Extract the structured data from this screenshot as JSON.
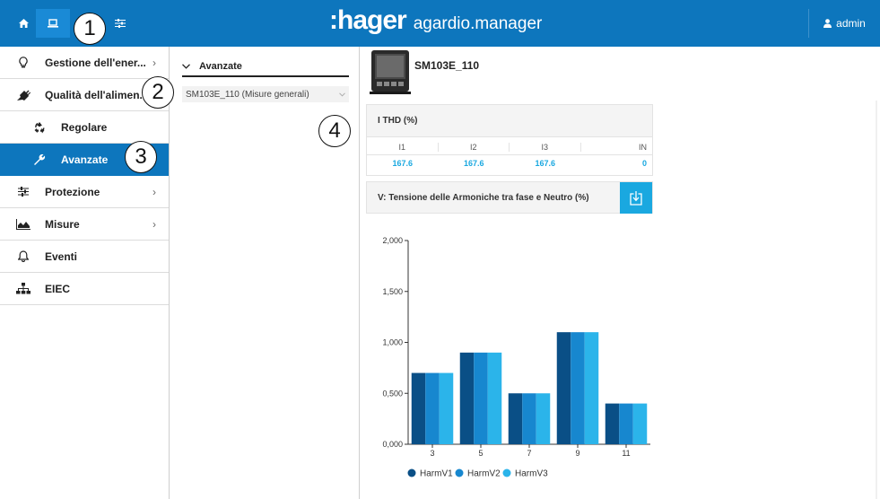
{
  "topbar": {
    "tabs": [
      {
        "name": "home",
        "icon": "home-icon"
      },
      {
        "name": "device",
        "icon": "laptop-icon"
      },
      {
        "name": "settings",
        "icon": "sliders-icon"
      }
    ],
    "brand_logo": ":hager",
    "brand_product": "agardio.manager",
    "user": "admin"
  },
  "callouts": [
    "1",
    "2",
    "3",
    "4"
  ],
  "sidebar": {
    "items": [
      {
        "label": "Gestione dell'ener...",
        "icon": "lightbulb-icon",
        "chevron": "›"
      },
      {
        "label": "Qualità dell'alimen.",
        "icon": "plug-icon",
        "chevron": ""
      },
      {
        "label": "Regolare",
        "icon": "recycle-icon",
        "chevron": ""
      },
      {
        "label": "Avanzate",
        "icon": "wrench-icon",
        "chevron": ""
      },
      {
        "label": "Protezione",
        "icon": "sliders-icon",
        "chevron": "›"
      },
      {
        "label": "Misure",
        "icon": "area-chart-icon",
        "chevron": "›"
      },
      {
        "label": "Eventi",
        "icon": "bell-icon",
        "chevron": ""
      },
      {
        "label": "EIEC",
        "icon": "sitemap-icon",
        "chevron": ""
      }
    ]
  },
  "middle": {
    "header": "Avanzate",
    "select_value": "SM103E_110 (Misure generali)"
  },
  "device": {
    "name": "SM103E_110"
  },
  "thd": {
    "title": "I THD (%)",
    "headers": [
      "I1",
      "I2",
      "I3",
      "IN"
    ],
    "values": [
      "167.6",
      "167.6",
      "167.6",
      "0"
    ]
  },
  "harmonics": {
    "title": "V: Tensione delle Armoniche tra fase e Neutro (%)"
  },
  "colors": {
    "primary": "#0d76bd",
    "accent": "#1aa8e0",
    "series": [
      "#0a4f86",
      "#1787cf",
      "#2bb4ea"
    ]
  },
  "chart_data": {
    "type": "bar",
    "title": "",
    "xlabel": "",
    "ylabel": "",
    "categories": [
      "3",
      "5",
      "7",
      "9",
      "11"
    ],
    "series": [
      {
        "name": "HarmV1",
        "values": [
          0.7,
          0.9,
          0.5,
          1.1,
          0.4
        ]
      },
      {
        "name": "HarmV2",
        "values": [
          0.7,
          0.9,
          0.5,
          1.1,
          0.4
        ]
      },
      {
        "name": "HarmV3",
        "values": [
          0.7,
          0.9,
          0.5,
          1.1,
          0.4
        ]
      }
    ],
    "ylim": [
      0,
      2
    ],
    "yticks": [
      "0,000",
      "0,500",
      "1,000",
      "1,500",
      "2,000"
    ],
    "legend": "bottom-left",
    "grid": false
  }
}
